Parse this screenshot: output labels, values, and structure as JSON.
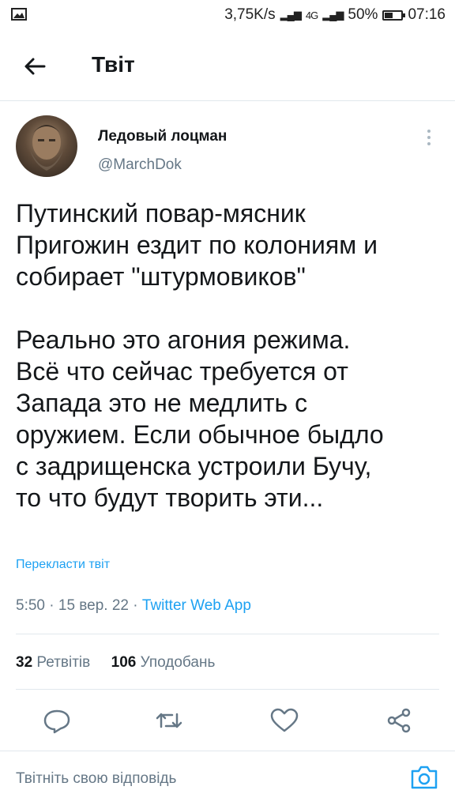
{
  "status_bar": {
    "speed": "3,75K/s",
    "network": "4G",
    "battery": "50%",
    "battery_level": 0.5,
    "time": "07:16"
  },
  "header": {
    "title": "Твіт"
  },
  "tweet": {
    "author_name": "Ледовый лоцман",
    "author_handle": "@MarchDok",
    "text": "Путинский повар-мясник\nПригожин ездит по колониям и\nсобирает \"штурмовиков\"\n\nРеально это агония режима.\nВсё что сейчас требуется от\nЗапада это не медлить с\nоружием. Если обычное быдло\nс задрищенска устроили Бучу,\nто что будут творить эти...",
    "translate_label": "Перекласти твіт",
    "time": "5:50",
    "date": "15 вер. 22",
    "separator": "·",
    "source": "Twitter Web App",
    "retweets_count": "32",
    "retweets_label": "Ретвітів",
    "likes_count": "106",
    "likes_label": "Уподобань"
  },
  "reply": {
    "placeholder": "Твітніть свою відповідь"
  },
  "colors": {
    "accent": "#1da1f2",
    "secondary_text": "#657786",
    "border": "#e1e8ed"
  },
  "icons": [
    "back-arrow-icon",
    "more-icon",
    "reply-icon",
    "retweet-icon",
    "like-icon",
    "share-icon",
    "camera-icon"
  ]
}
